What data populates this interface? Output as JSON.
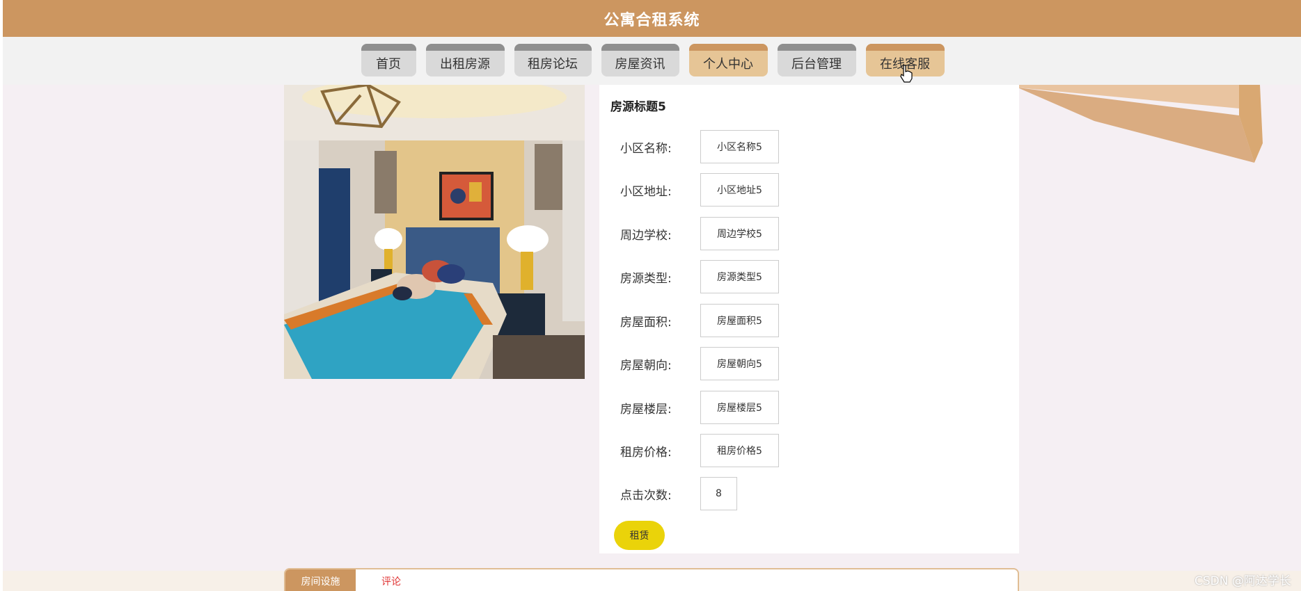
{
  "app": {
    "title": "公寓合租系统"
  },
  "nav": {
    "items": [
      {
        "label": "首页"
      },
      {
        "label": "出租房源"
      },
      {
        "label": "租房论坛"
      },
      {
        "label": "房屋资讯"
      },
      {
        "label": "个人中心",
        "active": true
      },
      {
        "label": "后台管理"
      },
      {
        "label": "在线客服",
        "active": true
      }
    ]
  },
  "listing": {
    "title": "房源标题5",
    "fields": [
      {
        "label": "小区名称:",
        "value": "小区名称5"
      },
      {
        "label": "小区地址:",
        "value": "小区地址5"
      },
      {
        "label": "周边学校:",
        "value": "周边学校5"
      },
      {
        "label": "房源类型:",
        "value": "房源类型5"
      },
      {
        "label": "房屋面积:",
        "value": "房屋面积5"
      },
      {
        "label": "房屋朝向:",
        "value": "房屋朝向5"
      },
      {
        "label": "房屋楼层:",
        "value": "房屋楼层5"
      },
      {
        "label": "租房价格:",
        "value": "租房价格5"
      },
      {
        "label": "点击次数:",
        "value": "8"
      }
    ],
    "rent_button": "租赁"
  },
  "tabs": {
    "facilities": "房间设施",
    "comments": "评论"
  },
  "watermark": "CSDN @阿达学长",
  "colors": {
    "header": "#cc9660",
    "nav_active": "#e6c596",
    "rent_button": "#ead30a",
    "comment_tab": "#e03434"
  },
  "icons": {
    "cursor": "hand-pointer-icon"
  }
}
